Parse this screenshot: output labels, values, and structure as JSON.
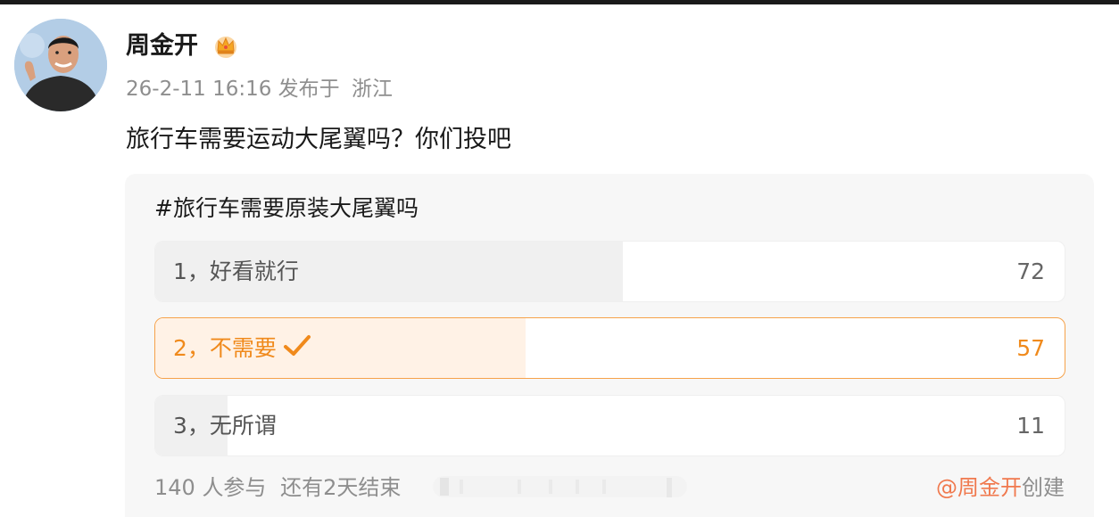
{
  "author": {
    "name": "周金开",
    "badge_icon": "crown-icon",
    "avatar_icon": "avatar-photo"
  },
  "post": {
    "time": "26-2-11 16:16",
    "published_from": "发布于",
    "location": "浙江",
    "text": "旅行车需要运动大尾翼吗？你们投吧"
  },
  "poll": {
    "title": "#旅行车需要原装大尾翼吗",
    "total_votes": 140,
    "options": [
      {
        "label": "1，好看就行",
        "count": "72",
        "share": 0.514,
        "selected": false
      },
      {
        "label": "2，不需要",
        "count": "57",
        "share": 0.407,
        "selected": true
      },
      {
        "label": "3，无所谓",
        "count": "11",
        "share": 0.079,
        "selected": false
      }
    ],
    "participants_text": "140 人参与",
    "remaining_text": "还有2天结束",
    "creator_handle": "@周金开",
    "creator_suffix": "创建"
  },
  "colors": {
    "accent_orange": "#f08a1c",
    "selected_border": "#f6a24a",
    "selected_fill": "#fff2e6",
    "creator_link": "#f0794e",
    "meta_gray": "#8e8e8e",
    "bar_fill": "#f0f0f0",
    "card_bg": "#f7f7f7"
  }
}
